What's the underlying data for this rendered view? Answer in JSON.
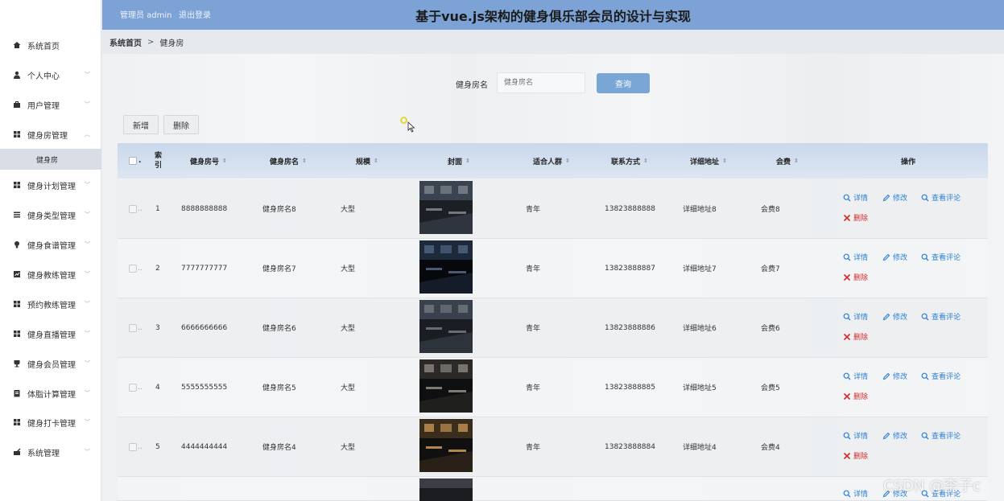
{
  "header": {
    "admin": "管理员 admin",
    "logout": "退出登录",
    "title": "基于vue.js架构的健身俱乐部会员的设计与实现"
  },
  "breadcrumb": {
    "home": "系统首页",
    "sep": ">",
    "current": "健身房"
  },
  "sidebar": {
    "items": [
      {
        "label": "系统首页",
        "icon": "home-icon"
      },
      {
        "label": "个人中心",
        "icon": "user-icon"
      },
      {
        "label": "用户管理",
        "icon": "briefcase-icon"
      },
      {
        "label": "健身房管理",
        "icon": "grid-icon"
      },
      {
        "label": "健身计划管理",
        "icon": "grid-icon"
      },
      {
        "label": "健身类型管理",
        "icon": "list-icon"
      },
      {
        "label": "健身食谱管理",
        "icon": "bulb-icon"
      },
      {
        "label": "健身教练管理",
        "icon": "chart-icon"
      },
      {
        "label": "预约教练管理",
        "icon": "grid-icon"
      },
      {
        "label": "健身直播管理",
        "icon": "grid-icon"
      },
      {
        "label": "健身会员管理",
        "icon": "cup-icon"
      },
      {
        "label": "体脂计算管理",
        "icon": "doc-icon"
      },
      {
        "label": "健身打卡管理",
        "icon": "grid-icon"
      },
      {
        "label": "系统管理",
        "icon": "edit-icon"
      }
    ],
    "sub": {
      "label": "健身房"
    }
  },
  "search": {
    "label": "健身房名",
    "placeholder": "健身房名",
    "button": "查询"
  },
  "actions": {
    "add": "新增",
    "delete": "删除"
  },
  "table": {
    "headers": {
      "index": "索引",
      "no": "健身房号",
      "name": "健身房名",
      "scale": "规模",
      "cover": "封面",
      "crowd": "适合人群",
      "contact": "联系方式",
      "address": "详细地址",
      "fee": "会费",
      "ops": "操作"
    },
    "ops": {
      "detail": "详情",
      "edit": "修改",
      "comments": "查看评论",
      "remove": "删除"
    },
    "rows": [
      {
        "index": "1",
        "no": "8888888888",
        "name": "健身房名8",
        "scale": "大型",
        "crowd": "青年",
        "contact": "13823888888",
        "address": "详细地址8",
        "fee": "会费8"
      },
      {
        "index": "2",
        "no": "7777777777",
        "name": "健身房名7",
        "scale": "大型",
        "crowd": "青年",
        "contact": "13823888887",
        "address": "详细地址7",
        "fee": "会费7"
      },
      {
        "index": "3",
        "no": "6666666666",
        "name": "健身房名6",
        "scale": "大型",
        "crowd": "青年",
        "contact": "13823888886",
        "address": "详细地址6",
        "fee": "会费6"
      },
      {
        "index": "4",
        "no": "5555555555",
        "name": "健身房名5",
        "scale": "大型",
        "crowd": "青年",
        "contact": "13823888885",
        "address": "详细地址5",
        "fee": "会费5"
      },
      {
        "index": "5",
        "no": "4444444444",
        "name": "健身房名4",
        "scale": "大型",
        "crowd": "青年",
        "contact": "13823888884",
        "address": "详细地址4",
        "fee": "会费4"
      }
    ]
  },
  "watermark": "CSDN @李子c"
}
